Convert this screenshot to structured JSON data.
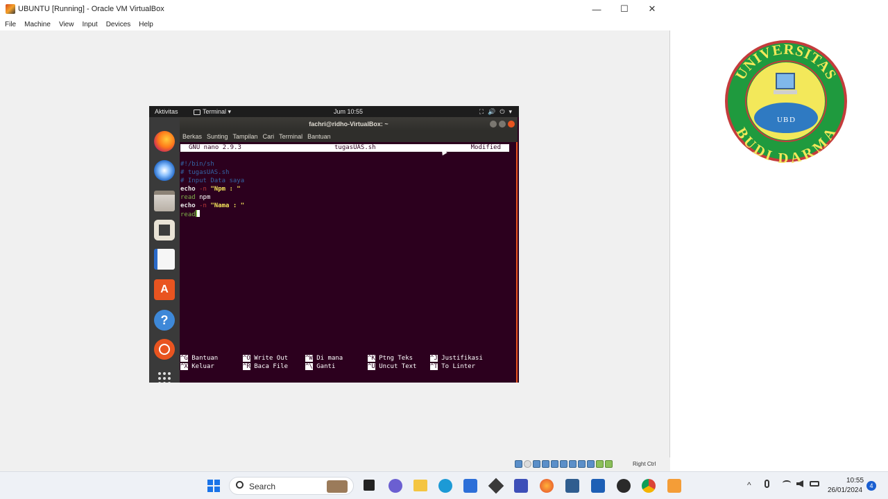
{
  "vbox": {
    "title": "UBUNTU [Running] - Oracle VM VirtualBox",
    "menu": [
      "File",
      "Machine",
      "View",
      "Input",
      "Devices",
      "Help"
    ],
    "min": "—",
    "max": "☐",
    "close": "✕",
    "host_key": "Right Ctrl"
  },
  "guest_topbar": {
    "activities": "Aktivitas",
    "app_menu": "Terminal ▾",
    "clock": "Jum 10:55",
    "sys_icons": [
      "⛶",
      "🔊",
      "⏻",
      "▾"
    ]
  },
  "terminal": {
    "title": "fachri@ridho-VirtualBox: ~",
    "menu": [
      "Berkas",
      "Sunting",
      "Tampilan",
      "Cari",
      "Terminal",
      "Bantuan"
    ]
  },
  "nano": {
    "version": "GNU nano 2.9.3",
    "filename": "tugasUAS.sh",
    "status": "Modified",
    "lines": [
      [
        {
          "t": "#!/bin/sh",
          "c": "c-cmt"
        }
      ],
      [
        {
          "t": "# tugasUAS.sh",
          "c": "c-cmt"
        }
      ],
      [
        {
          "t": "# Input Data saya",
          "c": "c-cmt"
        }
      ],
      [
        {
          "t": "echo",
          "c": "c-kw"
        },
        {
          "t": " -n ",
          "c": "c-opt"
        },
        {
          "t": "\"Npm : \"",
          "c": "c-str"
        }
      ],
      [
        {
          "t": "read",
          "c": "c-green"
        },
        {
          "t": " npm",
          "c": "c-txt"
        }
      ],
      [
        {
          "t": "echo",
          "c": "c-kw"
        },
        {
          "t": " -n ",
          "c": "c-opt"
        },
        {
          "t": "\"Nama : \"",
          "c": "c-str"
        }
      ],
      [
        {
          "t": "read",
          "c": "c-green"
        }
      ]
    ],
    "shortcuts": [
      {
        "key": "^G",
        "label": "Bantuan"
      },
      {
        "key": "^X",
        "label": "Keluar"
      },
      {
        "key": "^O",
        "label": "Write Out"
      },
      {
        "key": "^R",
        "label": "Baca File"
      },
      {
        "key": "^W",
        "label": "Di mana"
      },
      {
        "key": "^\\",
        "label": "Ganti"
      },
      {
        "key": "^K",
        "label": "Ptng Teks"
      },
      {
        "key": "^U",
        "label": "Uncut Text"
      },
      {
        "key": "^J",
        "label": "Justifikasi"
      },
      {
        "key": "^T",
        "label": "To Linter"
      }
    ]
  },
  "logo": {
    "top_text": "UNIVERSITAS",
    "bottom_text": "BUDI DARMA",
    "center_letters": [
      "U",
      "B",
      "D"
    ]
  },
  "taskbar": {
    "search": "Search",
    "time": "10:55",
    "date": "26/01/2024",
    "notif_count": "4"
  }
}
